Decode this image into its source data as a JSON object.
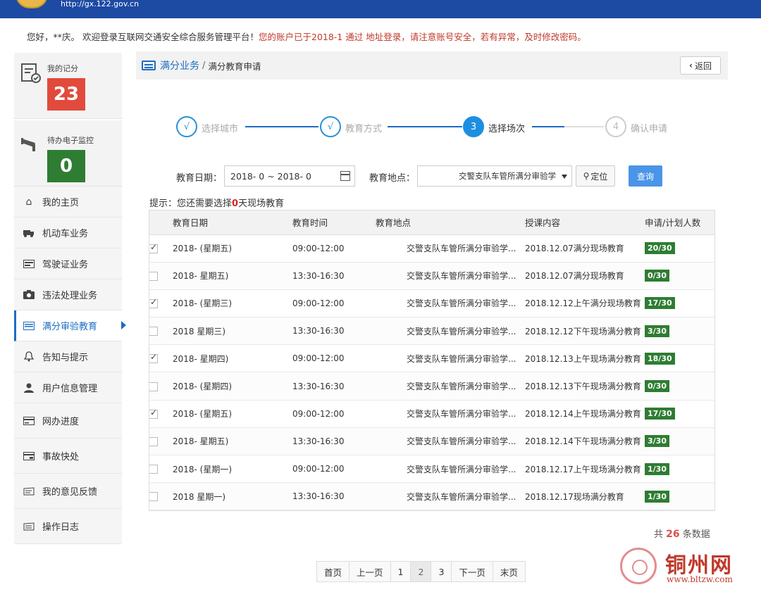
{
  "header": {
    "url": "http://gx.122.gov.cn"
  },
  "welcome": {
    "greeting": "您好，**庆。 欢迎登录互联网交通安全综合服务管理平台！",
    "warning": "您的账户已于2018-1 通过 地址登录，请注意账号安全，若有异常，及时修改密码。"
  },
  "sidebar": {
    "score_label": "我的记分",
    "score_value": "23",
    "monitor_label": "待办电子监控",
    "monitor_value": "0",
    "items": [
      {
        "label": "我的主页",
        "icon": "home-icon"
      },
      {
        "label": "机动车业务",
        "icon": "truck-icon"
      },
      {
        "label": "驾驶证业务",
        "icon": "id-card-icon"
      },
      {
        "label": "违法处理业务",
        "icon": "camera-icon"
      },
      {
        "label": "满分审验教育",
        "icon": "list-card-icon"
      },
      {
        "label": "告知与提示",
        "icon": "bell-icon"
      },
      {
        "label": "用户信息管理",
        "icon": "user-icon"
      },
      {
        "label": "网办进度",
        "icon": "progress-card-icon"
      },
      {
        "label": "事故快处",
        "icon": "accident-card-icon"
      },
      {
        "label": "我的意见反馈",
        "icon": "feedback-icon"
      },
      {
        "label": "操作日志",
        "icon": "log-icon"
      }
    ]
  },
  "breadcrumb": {
    "section": "满分业务",
    "separator": "/",
    "page": "满分教育申请",
    "back_label": "返回"
  },
  "steps": [
    {
      "num": "√",
      "label": "选择城市",
      "state": "done"
    },
    {
      "num": "√",
      "label": "教育方式",
      "state": "done"
    },
    {
      "num": "3",
      "label": "选择场次",
      "state": "current"
    },
    {
      "num": "4",
      "label": "确认申请",
      "state": "pending"
    }
  ],
  "filter": {
    "date_label": "教育日期：",
    "date_value": "2018- 0 ~ 2018- 0",
    "location_label": "教育地点：",
    "location_value": "交警支队车管所满分审验学",
    "locate_label": "定位",
    "query_label": "查询"
  },
  "tip": {
    "prefix": "提示：您还需要选择",
    "count": "0",
    "suffix": "天现场教育"
  },
  "table": {
    "headers": [
      "教育日期",
      "教育时间",
      "教育地点",
      "授课内容",
      "申请/计划人数"
    ],
    "rows": [
      {
        "checked": true,
        "date": "2018- (星期五)",
        "time": "09:00-12:00",
        "place": "交警支队车管所满分审验学...",
        "content": "2018.12.07满分现场教育",
        "count": "20/30"
      },
      {
        "checked": false,
        "date": "2018- 星期五)",
        "time": "13:30-16:30",
        "place": "交警支队车管所满分审验学...",
        "content": "2018.12.07满分现场教育",
        "count": "0/30"
      },
      {
        "checked": true,
        "date": "2018- (星期三)",
        "time": "09:00-12:00",
        "place": "交警支队车管所满分审验学...",
        "content": "2018.12.12上午满分现场教育",
        "count": "17/30"
      },
      {
        "checked": false,
        "date": "2018 星期三)",
        "time": "13:30-16:30",
        "place": "交警支队车管所满分审验学...",
        "content": "2018.12.12下午现场满分教育",
        "count": "3/30"
      },
      {
        "checked": true,
        "date": "2018- 星期四)",
        "time": "09:00-12:00",
        "place": "交警支队车管所满分审验学...",
        "content": "2018.12.13上午现场满分教育",
        "count": "18/30"
      },
      {
        "checked": false,
        "date": "2018- (星期四)",
        "time": "13:30-16:30",
        "place": "交警支队车管所满分审验学...",
        "content": "2018.12.13下午现场满分教育",
        "count": "0/30"
      },
      {
        "checked": true,
        "date": "2018- (星期五)",
        "time": "09:00-12:00",
        "place": "交警支队车管所满分审验学...",
        "content": "2018.12.14上午现场满分教育",
        "count": "17/30"
      },
      {
        "checked": false,
        "date": "2018- 星期五)",
        "time": "13:30-16:30",
        "place": "交警支队车管所满分审验学...",
        "content": "2018.12.14下午现场满分教育",
        "count": "3/30"
      },
      {
        "checked": false,
        "date": "2018- (星期一)",
        "time": "09:00-12:00",
        "place": "交警支队车管所满分审验学...",
        "content": "2018.12.17上午现场满分教育",
        "count": "1/30"
      },
      {
        "checked": false,
        "date": "2018 星期一)",
        "time": "13:30-16:30",
        "place": "交警支队车管所满分审验学...",
        "content": "2018.12.17现场满分教育",
        "count": "1/30"
      }
    ]
  },
  "total": {
    "prefix": "共",
    "count": "26",
    "suffix": "条数据"
  },
  "pagination": [
    "首页",
    "上一页",
    "1",
    "2",
    "3",
    "下一页",
    "末页"
  ],
  "current_page": "2",
  "watermark": {
    "title": "铜州网",
    "url": "www.bltzw.com"
  },
  "colors": {
    "brand_blue": "#1d4aa3",
    "accent_blue": "#1d6dc3",
    "score_red": "#e14a3c",
    "monitor_green": "#2e7d32",
    "badge_green": "#2e7d32"
  }
}
